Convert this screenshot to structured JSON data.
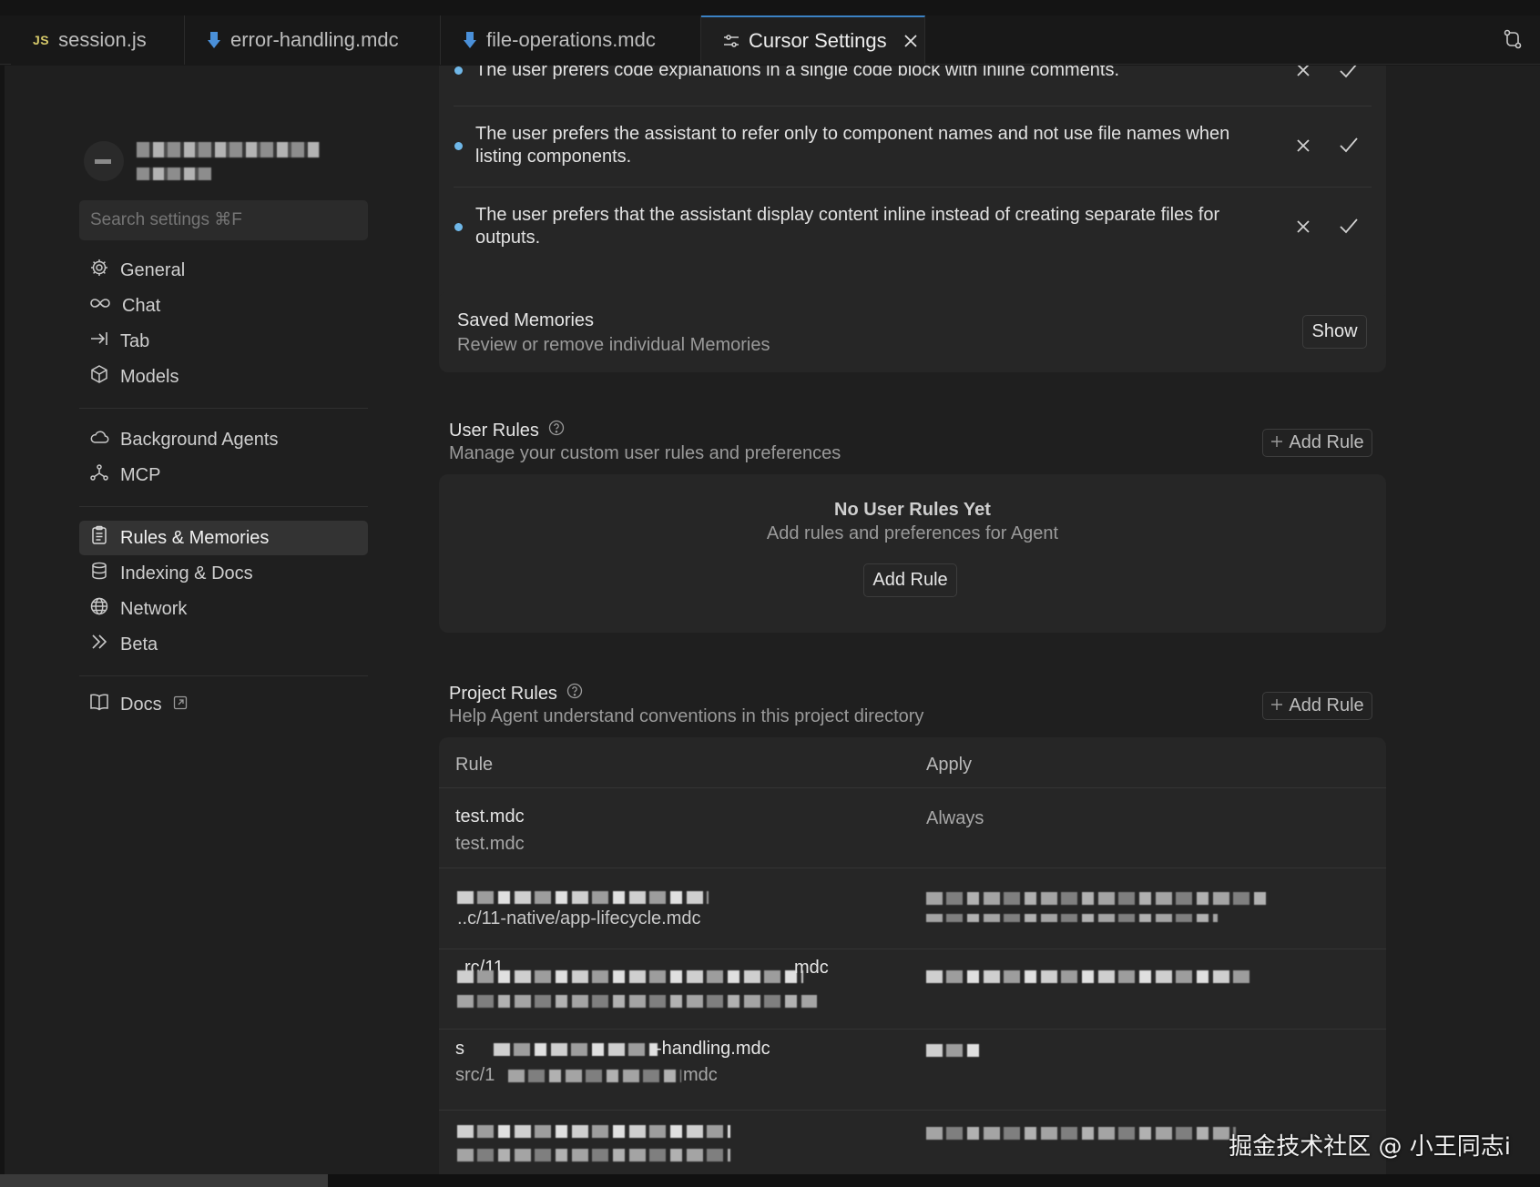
{
  "tabs": [
    {
      "label": "session.js",
      "badge": "JS"
    },
    {
      "label": "error-handling.mdc"
    },
    {
      "label": "file-operations.mdc"
    },
    {
      "label": "Cursor Settings"
    }
  ],
  "sidebar": {
    "search_placeholder": "Search settings ⌘F",
    "items": [
      {
        "label": "General",
        "icon": "gear-icon"
      },
      {
        "label": "Chat",
        "icon": "infinity-icon"
      },
      {
        "label": "Tab",
        "icon": "arrow-right-bar-icon"
      },
      {
        "label": "Models",
        "icon": "cube-icon"
      },
      {
        "label": "Background Agents",
        "icon": "cloud-icon"
      },
      {
        "label": "MCP",
        "icon": "network-nodes-icon"
      },
      {
        "label": "Rules & Memories",
        "icon": "clipboard-icon",
        "active": true
      },
      {
        "label": "Indexing & Docs",
        "icon": "database-icon"
      },
      {
        "label": "Network",
        "icon": "globe-icon"
      },
      {
        "label": "Beta",
        "icon": "chevrons-right-icon"
      },
      {
        "label": "Docs",
        "icon": "book-icon"
      }
    ]
  },
  "memories": [
    {
      "text": "The user prefers code explanations in a single code block with inline comments."
    },
    {
      "text": "The user prefers the assistant to refer only to component names and not use file names when listing components."
    },
    {
      "text": "The user prefers that the assistant display content inline instead of creating separate files for outputs."
    }
  ],
  "saved_memories": {
    "title": "Saved Memories",
    "subtitle": "Review or remove individual Memories",
    "button": "Show"
  },
  "user_rules": {
    "title": "User Rules",
    "subtitle": "Manage your custom user rules and preferences",
    "add_button": "Add Rule",
    "empty_title": "No User Rules Yet",
    "empty_subtitle": "Add rules and preferences for Agent",
    "empty_button": "Add Rule"
  },
  "project_rules": {
    "title": "Project Rules",
    "subtitle": "Help Agent understand conventions in this project directory",
    "add_button": "Add Rule",
    "columns": [
      "Rule",
      "Apply"
    ],
    "rows": [
      {
        "name": "test.mdc",
        "path": "test.mdc",
        "apply": "Always"
      },
      {
        "path_fragment": "..c/11-native/app-lifecycle.mdc"
      },
      {
        "path_fragment_a": "rc/11",
        "path_fragment_b": "mdc"
      },
      {
        "path_fragment_a": "s",
        "path_fragment_b": "-handling.mdc",
        "path_fragment_c": "src/1",
        "path_fragment_d": "mdc"
      }
    ]
  },
  "watermark": "掘金技术社区 @ 小王同志i",
  "colors": {
    "background": "#1f1f1f",
    "card": "#262626",
    "accent_bullet": "#6fb7e8",
    "active_tab_border": "#3b82c4"
  }
}
